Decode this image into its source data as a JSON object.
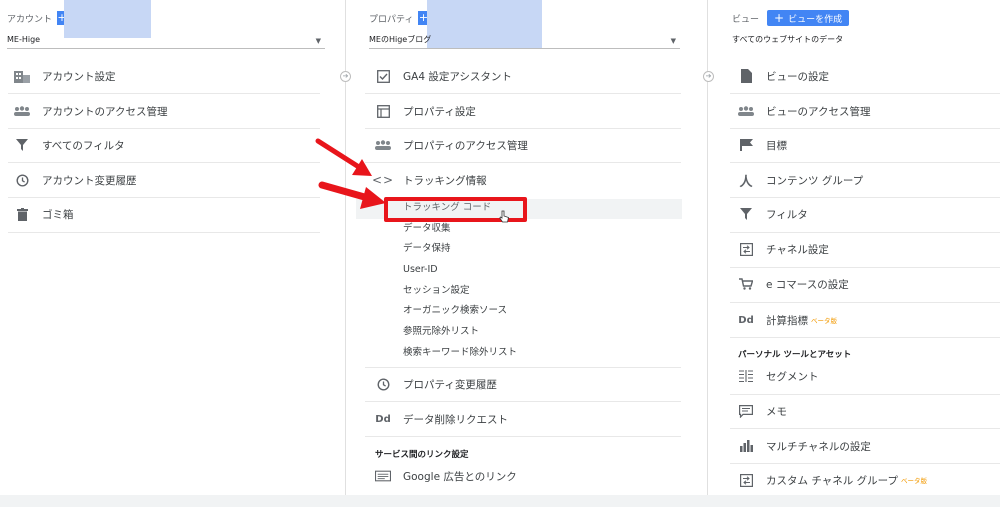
{
  "account": {
    "header_label": "アカウント",
    "selected": "ME-Hige",
    "items": [
      {
        "icon": "building-icon",
        "label": "アカウント設定"
      },
      {
        "icon": "people-icon",
        "label": "アカウントのアクセス管理"
      },
      {
        "icon": "filter-icon",
        "label": "すべてのフィルタ"
      },
      {
        "icon": "history-icon",
        "label": "アカウント変更履歴"
      },
      {
        "icon": "trash-icon",
        "label": "ゴミ箱"
      }
    ]
  },
  "property": {
    "header_label": "プロパティ",
    "selected": "MEのHigeブログ",
    "items": [
      {
        "icon": "checklist-icon",
        "label": "GA4 設定アシスタント"
      },
      {
        "icon": "window-icon",
        "label": "プロパティ設定"
      },
      {
        "icon": "people-icon",
        "label": "プロパティのアクセス管理"
      },
      {
        "icon": "code-icon",
        "label": "トラッキング情報"
      }
    ],
    "tracking_subitems": [
      "トラッキング コード",
      "データ収集",
      "データ保持",
      "User-ID",
      "セッション設定",
      "オーガニック検索ソース",
      "参照元除外リスト",
      "検索キーワード除外リスト"
    ],
    "history_label": "プロパティ変更履歴",
    "deletion_label": "データ削除リクエスト",
    "dd_icon_text": "Dd",
    "service_section": "サービス間のリンク設定",
    "google_ads_label": "Google 広告とのリンク"
  },
  "view": {
    "header_label": "ビュー",
    "create_label": "ビューを作成",
    "selected": "すべてのウェブサイトのデータ",
    "items": [
      {
        "icon": "document-icon",
        "label": "ビューの設定"
      },
      {
        "icon": "people-icon",
        "label": "ビューのアクセス管理"
      },
      {
        "icon": "flag-icon",
        "label": "目標"
      },
      {
        "icon": "person-walk-icon",
        "label": "コンテンツ グループ"
      },
      {
        "icon": "filter-icon",
        "label": "フィルタ"
      },
      {
        "icon": "channel-icon",
        "label": "チャネル設定"
      },
      {
        "icon": "cart-icon",
        "label": "e コマースの設定"
      }
    ],
    "calc_label": "計算指標",
    "calc_beta": "ベータ版",
    "dd_icon_text": "Dd",
    "personal_section": "パーソナル ツールとアセット",
    "personal_items": [
      {
        "icon": "segment-icon",
        "label": "セグメント"
      },
      {
        "icon": "memo-icon",
        "label": "メモ"
      },
      {
        "icon": "bar-chart-icon",
        "label": "マルチチャネルの設定"
      }
    ],
    "custom_channel_label": "カスタム チャネル グループ",
    "custom_channel_beta": "ベータ版"
  },
  "colors": {
    "accent": "#4285f4",
    "annotation_red": "#e8151b",
    "beta": "#f29900"
  }
}
